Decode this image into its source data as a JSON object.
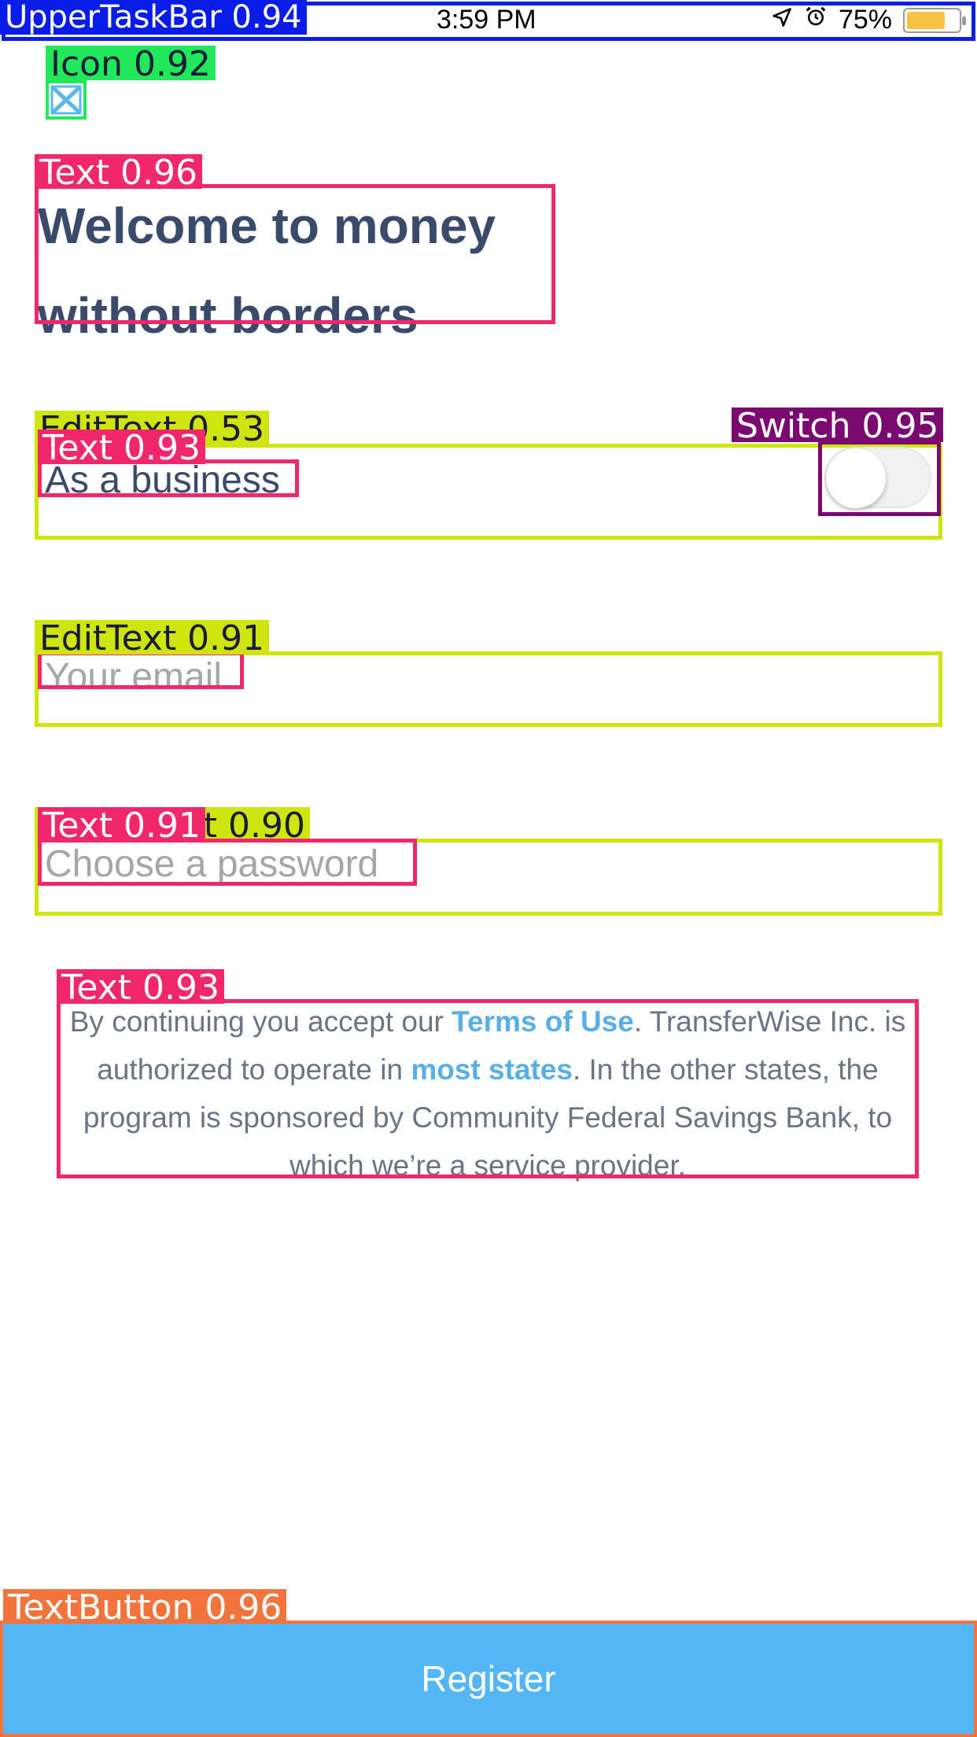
{
  "status_bar": {
    "time": "3:59 PM",
    "battery": "75%",
    "battery_level": 0.75
  },
  "title": "Welcome to money without borders",
  "business_field": {
    "label": "As a business",
    "switch_on": false
  },
  "email_field": {
    "placeholder": "Your email"
  },
  "password_field": {
    "placeholder": "Choose a password"
  },
  "legal": {
    "part1": "By continuing you accept our ",
    "terms_link": "Terms of Use",
    "part2": ". TransferWise Inc. is authorized to operate in ",
    "states_link": "most states",
    "part3": ". In the other states, the program is sponsored by Community Federal Savings Bank, to which we’re a service provider."
  },
  "register_button": "Register",
  "annotations": {
    "status_bar": "UpperTaskBar 0.94",
    "icon": "Icon 0.92",
    "title": "Text 0.96",
    "edit_business": "EditText 0.53",
    "switch": "Switch 0.95",
    "text_business": "Text 0.93",
    "edit_email": "EditText 0.91",
    "edit_password": "EditText 0.90",
    "text_password": "Text 0.91",
    "legal": "Text 0.93",
    "button": "TextButton 0.96"
  },
  "colors": {
    "status": "#0a1de8",
    "icon": "#20e85a",
    "text": "#f0276a",
    "edit": "#cfe50f",
    "switch": "#7a0a70",
    "button": "#f2743c",
    "accent": "#55b6f5"
  }
}
